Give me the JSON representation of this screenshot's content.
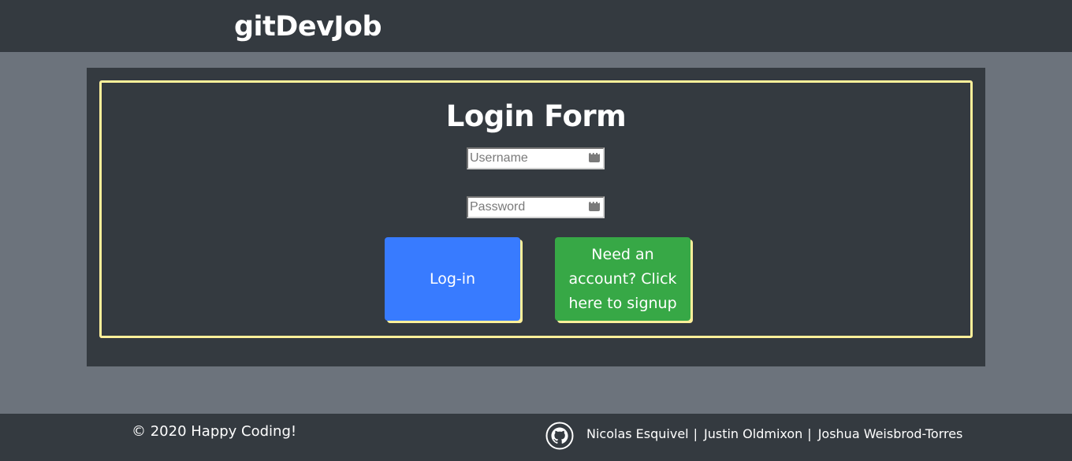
{
  "header": {
    "brand": "gitDevJob"
  },
  "form": {
    "title": "Login Form",
    "username_placeholder": "Username",
    "password_placeholder": "Password",
    "login_label": "Log-in",
    "signup_label": "Need an account? Click here to signup"
  },
  "footer": {
    "copyright": "© 2020 Happy Coding!",
    "github_icon": "github-icon",
    "authors": [
      "Nicolas Esquivel",
      "Justin Oldmixon",
      "Joshua Weisbrod-Torres"
    ],
    "separator": "|"
  },
  "colors": {
    "header_bg": "#343a40",
    "page_bg": "#6c737c",
    "accent_border": "#fff09a",
    "login_button": "#387bff",
    "signup_button": "#37a846"
  }
}
